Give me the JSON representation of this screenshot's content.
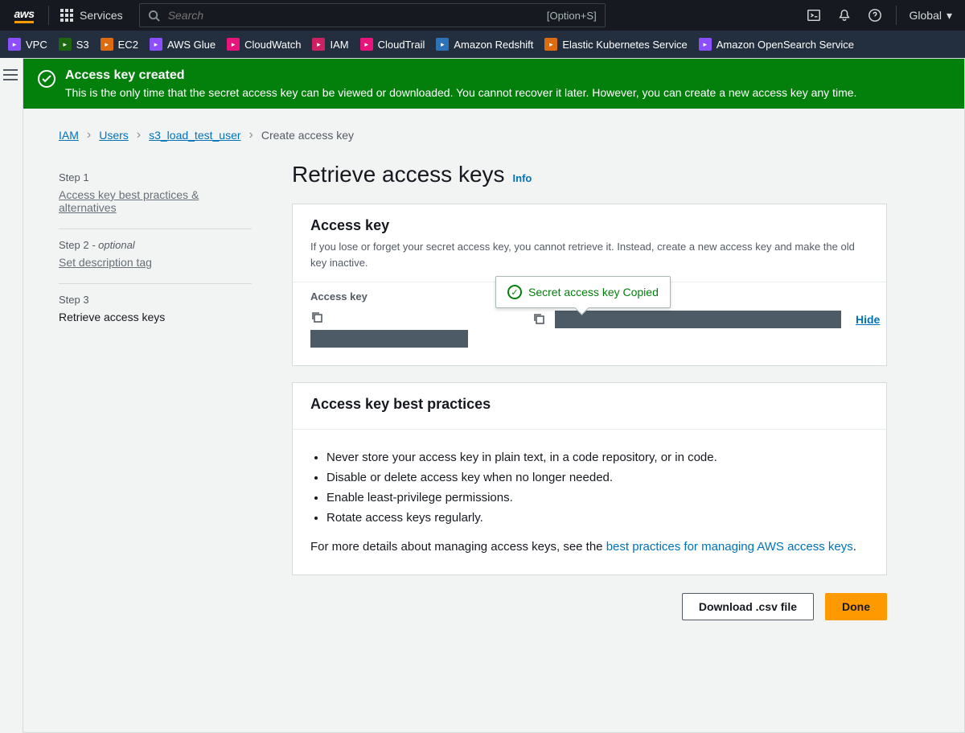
{
  "top": {
    "services": "Services",
    "search_placeholder": "Search",
    "shortcut": "[Option+S]",
    "region": "Global"
  },
  "shortcuts": [
    {
      "label": "VPC",
      "color": "purple"
    },
    {
      "label": "S3",
      "color": "green"
    },
    {
      "label": "EC2",
      "color": "orange"
    },
    {
      "label": "AWS Glue",
      "color": "purple"
    },
    {
      "label": "CloudWatch",
      "color": "pink"
    },
    {
      "label": "IAM",
      "color": "red"
    },
    {
      "label": "CloudTrail",
      "color": "pink"
    },
    {
      "label": "Amazon Redshift",
      "color": "blue"
    },
    {
      "label": "Elastic Kubernetes Service",
      "color": "orange"
    },
    {
      "label": "Amazon OpenSearch Service",
      "color": "purple"
    }
  ],
  "banner": {
    "title": "Access key created",
    "body": "This is the only time that the secret access key can be viewed or downloaded. You cannot recover it later. However, you can create a new access key any time."
  },
  "breadcrumbs": {
    "iam": "IAM",
    "users": "Users",
    "user": "s3_load_test_user",
    "current": "Create access key"
  },
  "steps": {
    "s1": {
      "label": "Step 1",
      "title": "Access key best practices & alternatives"
    },
    "s2": {
      "label": "Step 2",
      "opt": "- optional",
      "title": "Set description tag"
    },
    "s3": {
      "label": "Step 3",
      "title": "Retrieve access keys"
    }
  },
  "main": {
    "heading": "Retrieve access keys",
    "info": "Info",
    "panel1": {
      "title": "Access key",
      "desc": "If you lose or forget your secret access key, you cannot retrieve it. Instead, create a new access key and make the old key inactive.",
      "col1": "Access key",
      "hide": "Hide",
      "tooltip": "Secret access key Copied"
    },
    "panel2": {
      "title": "Access key best practices",
      "bullets": [
        "Never store your access key in plain text, in a code repository, or in code.",
        "Disable or delete access key when no longer needed.",
        "Enable least-privilege permissions.",
        "Rotate access keys regularly."
      ],
      "more_pre": "For more details about managing access keys, see the ",
      "more_link": "best practices for managing AWS access keys",
      "more_post": "."
    },
    "actions": {
      "download": "Download .csv file",
      "done": "Done"
    }
  }
}
